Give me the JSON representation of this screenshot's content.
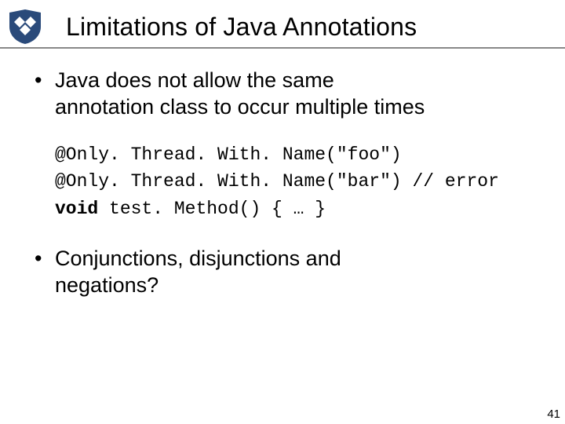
{
  "header": {
    "title": "Limitations of Java Annotations"
  },
  "bullets": {
    "item1_line1": "Java does not allow the same",
    "item1_line2": "annotation class to occur multiple times",
    "item2_line1": "Conjunctions, disjunctions and",
    "item2_line2": "negations?"
  },
  "code": {
    "line1": "@Only. Thread. With. Name(\"foo\")",
    "line2_a": "@Only. Thread. With. Name(\"bar\") ",
    "line2_b": "// error",
    "line3_kw": "void",
    "line3_rest": " test. Method() { … }"
  },
  "page_number": "41",
  "logo": {
    "bg": "#2a4a7a",
    "fg": "#ffffff"
  }
}
